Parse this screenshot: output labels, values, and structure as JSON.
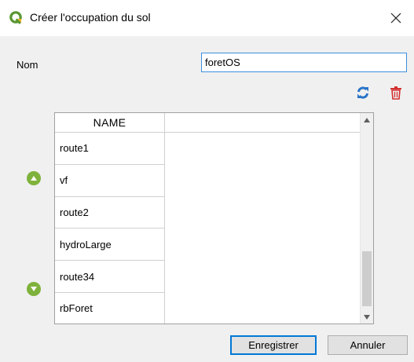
{
  "window": {
    "title": "Créer l'occupation du sol"
  },
  "form": {
    "name_label": "Nom",
    "name_value": "foretOS"
  },
  "toolbar": {
    "refresh_icon": "refresh-icon",
    "delete_icon": "trash-icon"
  },
  "table": {
    "header": "NAME",
    "rows": [
      "route1",
      "vf",
      "route2",
      "hydroLarge",
      "route34",
      "rbForet"
    ]
  },
  "buttons": {
    "save_label": "Enregistrer",
    "cancel_label": "Annuler"
  },
  "colors": {
    "qgis_green": "#589632",
    "qgis_yellow": "#f0b429",
    "refresh_blue": "#2a74c8",
    "delete_red": "#d32f2f",
    "arrow_green": "#7fb23c",
    "focus_blue": "#3c8fdc"
  }
}
